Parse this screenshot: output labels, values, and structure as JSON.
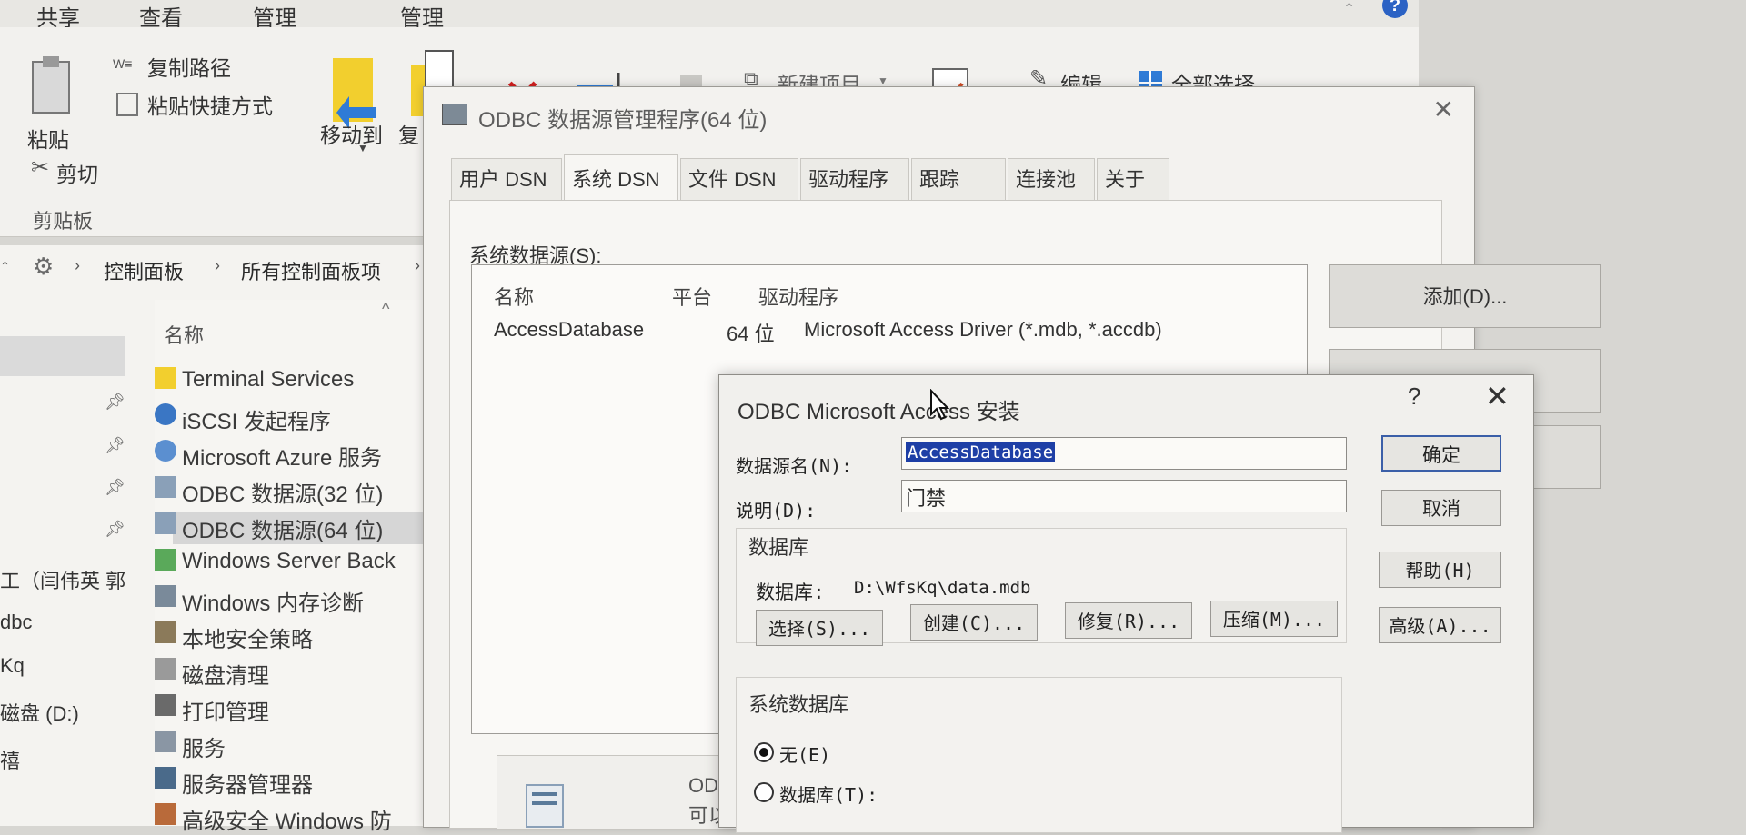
{
  "explorer": {
    "ribbon_tabs": [
      "共享",
      "查看",
      "管理",
      "管理"
    ],
    "help_icon": "?",
    "clipboard": {
      "paste": "粘贴",
      "copy_path": "复制路径",
      "paste_shortcut": "粘贴快捷方式",
      "cut": "剪切",
      "group": "剪贴板"
    },
    "organize": {
      "move_to": "移动到",
      "copy_to": "复"
    },
    "new_item": "新建项目",
    "edit": "编辑",
    "select_all": "全部选择",
    "breadcrumb": [
      "控制面板",
      "所有控制面板项"
    ],
    "column_name": "名称",
    "items": [
      "Terminal Services",
      "iSCSI 发起程序",
      "Microsoft Azure 服务",
      "ODBC 数据源(32 位)",
      "ODBC 数据源(64 位)",
      "Windows Server Back",
      "Windows 内存诊断",
      "本地安全策略",
      "磁盘清理",
      "打印管理",
      "服务",
      "服务器管理器",
      "高级安全 Windows 防"
    ],
    "nav_items": [
      "工（闫伟英 郭",
      "dbc",
      "Kq",
      "磁盘 (D:)",
      "禧"
    ]
  },
  "admin": {
    "title": "ODBC 数据源管理程序(64 位)",
    "tabs": [
      "用户 DSN",
      "系统 DSN",
      "文件 DSN",
      "驱动程序",
      "跟踪",
      "连接池",
      "关于"
    ],
    "system_sources_label": "系统数据源(S):",
    "columns": [
      "名称",
      "平台",
      "驱动程序"
    ],
    "rows": [
      {
        "name": "AccessDatabase",
        "platform": "64 位",
        "driver": "Microsoft Access Driver (*.mdb, *.accdb)"
      }
    ],
    "add_button": "添加(D)...",
    "bottom_text_1": "ODBC 系统数",
    "bottom_text_2": "可以(包括 N",
    "user_fragment": "用户"
  },
  "setup": {
    "title": "ODBC Microsoft Access 安装",
    "help": "?",
    "close": "✕",
    "dsn_label": "数据源名(N):",
    "dsn_value": "AccessDatabase",
    "desc_label": "说明(D):",
    "desc_value": "门禁",
    "db_group": "数据库",
    "db_label": "数据库:",
    "db_path": "D:\\WfsKq\\data.mdb",
    "select_btn": "选择(S)...",
    "create_btn": "创建(C)...",
    "repair_btn": "修复(R)...",
    "compact_btn": "压缩(M)...",
    "ok_btn": "确定",
    "cancel_btn": "取消",
    "help_btn": "帮助(H)",
    "advanced_btn": "高级(A)...",
    "sysdb_group": "系统数据库",
    "radio_none": "无(E)",
    "radio_db": "数据库(T):"
  }
}
